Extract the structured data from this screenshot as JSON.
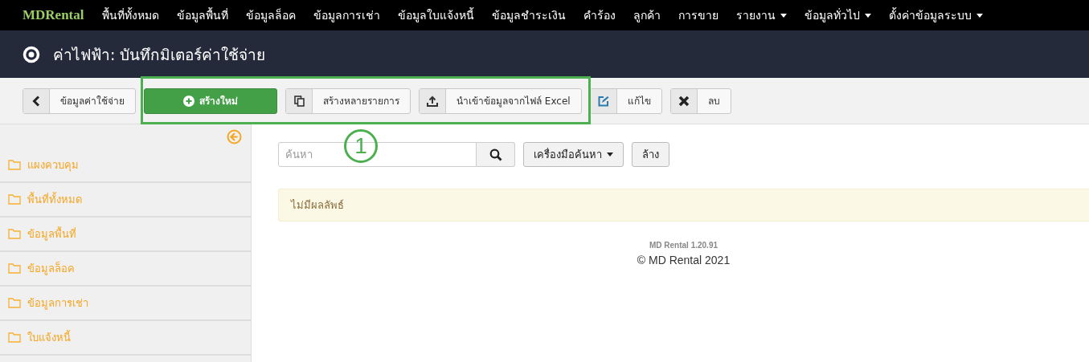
{
  "navbar": {
    "brand": "MDRental",
    "items": [
      {
        "label": "พื้นที่ทั้งหมด",
        "dropdown": false
      },
      {
        "label": "ข้อมูลพื้นที่",
        "dropdown": false
      },
      {
        "label": "ข้อมูลล็อค",
        "dropdown": false
      },
      {
        "label": "ข้อมูลการเช่า",
        "dropdown": false
      },
      {
        "label": "ข้อมูลใบแจ้งหนี้",
        "dropdown": false
      },
      {
        "label": "ข้อมูลชำระเงิน",
        "dropdown": false
      },
      {
        "label": "คำร้อง",
        "dropdown": false
      },
      {
        "label": "ลูกค้า",
        "dropdown": false
      },
      {
        "label": "การขาย",
        "dropdown": false
      },
      {
        "label": "รายงาน",
        "dropdown": true
      },
      {
        "label": "ข้อมูลทั่วไป",
        "dropdown": true
      },
      {
        "label": "ตั้งค่าข้อมูลระบบ",
        "dropdown": true
      }
    ]
  },
  "page_title": "ค่าไฟฟ้า: บันทึกมิเตอร์ค่าใช้จ่าย",
  "toolbar": [
    {
      "label": "ข้อมูลค่าใช้จ่าย",
      "kind": "back"
    },
    {
      "label": "สร้างใหม่",
      "kind": "create"
    },
    {
      "label": "สร้างหลายรายการ",
      "kind": "copy"
    },
    {
      "label": "นำเข้าข้อมูลจากไฟล์ Excel",
      "kind": "upload"
    },
    {
      "label": "แก้ไข",
      "kind": "edit"
    },
    {
      "label": "ลบ",
      "kind": "delete"
    }
  ],
  "annotation": {
    "number": "1"
  },
  "sidebar": {
    "items": [
      "แผงควบคุม",
      "พื้นที่ทั้งหมด",
      "ข้อมูลพื้นที่",
      "ข้อมูลล็อค",
      "ข้อมูลการเช่า",
      "ใบแจ้งหนี้"
    ]
  },
  "search": {
    "placeholder": "ค้นหา",
    "tools_label": "เครื่องมือค้นหา",
    "clear_label": "ล้าง"
  },
  "alert": "ไม่มีผลลัพธ์",
  "footer": {
    "version": "MD Rental 1.20.91",
    "copyright": "© MD Rental 2021"
  }
}
